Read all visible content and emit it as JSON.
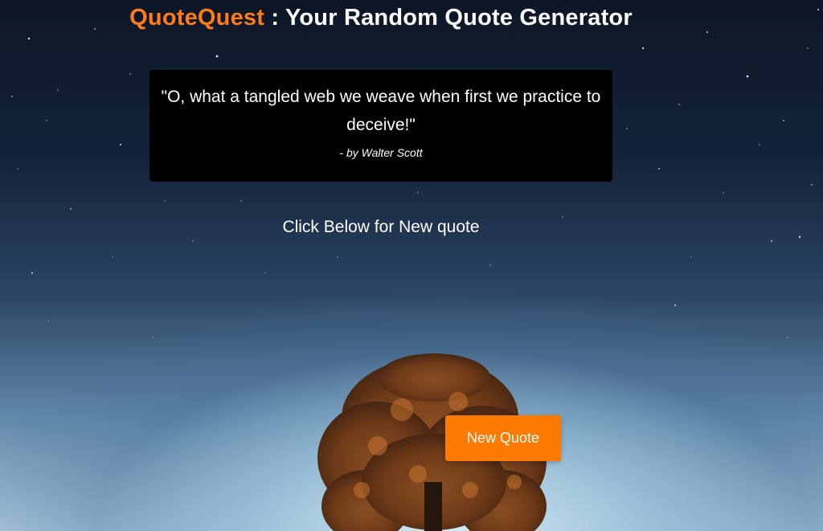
{
  "header": {
    "brand": "QuoteQuest",
    "subtitle": ": Your Random Quote Generator"
  },
  "quote": {
    "text": "\"O, what a tangled web we weave when first we practice to deceive!\"",
    "author": "- by Walter Scott"
  },
  "prompt": "Click Below for New quote",
  "button": {
    "label": "New Quote"
  },
  "colors": {
    "accent": "#ff7a00",
    "quote_box": "#000000",
    "text": "#ffffff"
  }
}
